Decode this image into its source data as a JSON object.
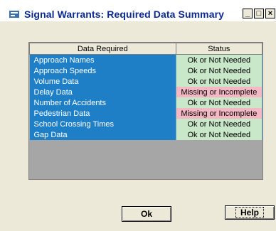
{
  "window": {
    "title": "Signal Warrants: Required Data Summary",
    "controls": {
      "minimize": "_",
      "maximize": "□",
      "close": "×"
    }
  },
  "grid": {
    "headers": [
      "Data Required",
      "Status"
    ],
    "rows": [
      {
        "name": "Approach Names",
        "status": "Ok or Not Needed",
        "state": "ok"
      },
      {
        "name": "Approach Speeds",
        "status": "Ok or Not Needed",
        "state": "ok"
      },
      {
        "name": "Volume Data",
        "status": "Ok or Not Needed",
        "state": "ok"
      },
      {
        "name": "Delay Data",
        "status": "Missing or Incomplete",
        "state": "bad"
      },
      {
        "name": "Number of Accidents",
        "status": "Ok or Not Needed",
        "state": "ok"
      },
      {
        "name": "Pedestrian Data",
        "status": "Missing or Incomplete",
        "state": "bad"
      },
      {
        "name": "School Crossing Times",
        "status": "Ok or Not Needed",
        "state": "ok"
      },
      {
        "name": "Gap Data",
        "status": "Ok or Not Needed",
        "state": "ok"
      }
    ]
  },
  "buttons": {
    "ok": "Ok",
    "help": "Help"
  },
  "colors": {
    "name_cell": "#1e7fc6",
    "ok_cell": "#c9e7c9",
    "bad_cell": "#f4b8c4",
    "title": "#0a2a8f"
  }
}
